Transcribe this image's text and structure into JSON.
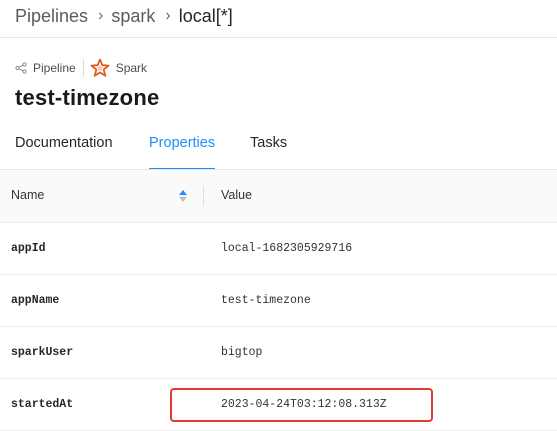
{
  "breadcrumb": {
    "items": [
      "Pipelines",
      "spark",
      "local[*]"
    ],
    "separator": "›"
  },
  "entity": {
    "type_label": "Pipeline",
    "type_icon": "share-nodes-icon",
    "platform_label": "Spark",
    "platform_icon": "spark-star-icon",
    "platform_color": "#e25a1c",
    "title": "test-timezone"
  },
  "tabs": [
    {
      "label": "Documentation",
      "active": false
    },
    {
      "label": "Properties",
      "active": true
    },
    {
      "label": "Tasks",
      "active": false
    }
  ],
  "accent_color": "#1890ff",
  "properties_table": {
    "columns": {
      "name": "Name",
      "value": "Value"
    },
    "sort_icon": "sort-up-down-icon",
    "rows": [
      {
        "key": "appId",
        "value": "local-1682305929716"
      },
      {
        "key": "appName",
        "value": "test-timezone"
      },
      {
        "key": "sparkUser",
        "value": "bigtop"
      },
      {
        "key": "startedAt",
        "value": "2023-04-24T03:12:08.313Z"
      }
    ]
  },
  "highlight": {
    "row": "startedAt",
    "color": "#e53935"
  }
}
